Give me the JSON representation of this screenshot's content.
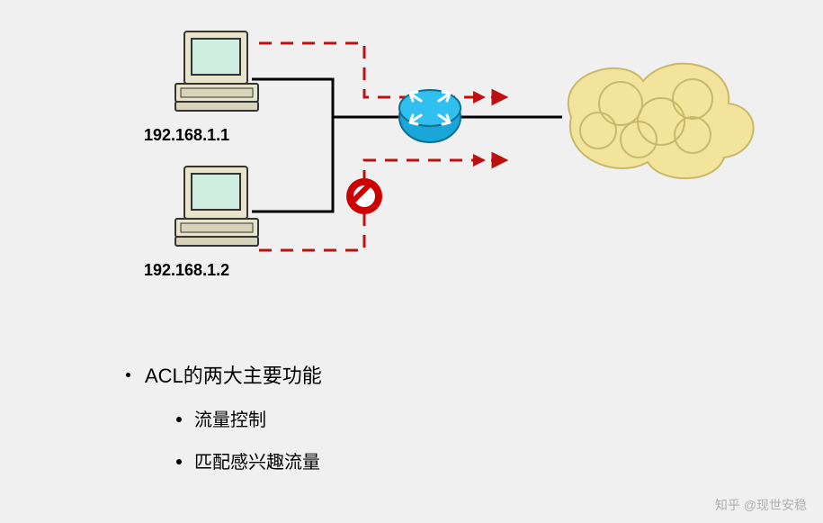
{
  "diagram": {
    "hosts": [
      {
        "ip": "192.168.1.1",
        "allowed": true
      },
      {
        "ip": "192.168.1.2",
        "allowed": false
      }
    ],
    "device": "router",
    "destination": "cloud-network",
    "flow_paths": [
      {
        "from": "192.168.1.1",
        "to": "cloud",
        "permitted": true
      },
      {
        "from": "192.168.1.2",
        "to": "cloud",
        "permitted": false
      }
    ]
  },
  "text": {
    "heading": "ACL的两大主要功能",
    "sub1": "流量控制",
    "sub2": "匹配感兴趣流量"
  },
  "watermark": "知乎 @现世安稳"
}
